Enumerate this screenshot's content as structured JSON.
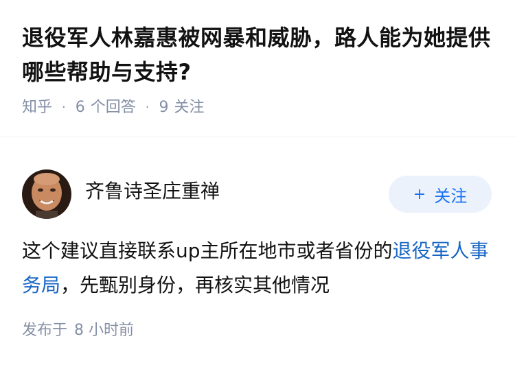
{
  "question": {
    "title": "退役军人林嘉惠被网暴和威胁，路人能为她提供哪些帮助与支持?",
    "source": "知乎",
    "answer_count": "6",
    "answer_label": "个回答",
    "follow_count": "9",
    "follow_label": "关注"
  },
  "answer": {
    "author_name": "齐鲁诗圣庄重禅",
    "follow_button_label": "关注",
    "follow_button_icon": "plus-icon",
    "body_before_link": "这个建议直接联系up主所在地市或者省份的",
    "body_link": "退役军人事务局",
    "body_after_link": "，先甄别身份，再核实其他情况",
    "published_label": "发布于",
    "published_time": "8 小时前"
  },
  "colors": {
    "link": "#1765c4",
    "accent": "#1772f6",
    "meta": "#8590a6",
    "button_bg": "#ebf2fb"
  }
}
